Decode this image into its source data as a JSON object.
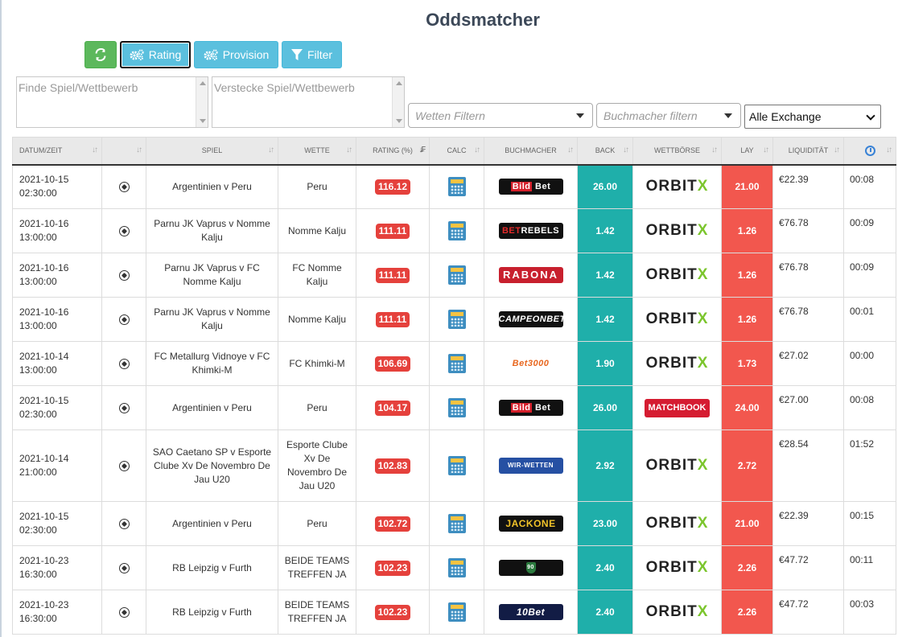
{
  "page": {
    "title": "Oddsmatcher"
  },
  "toolbar": {
    "rating_label": "Rating",
    "provision_label": "Provision",
    "filter_label": "Filter"
  },
  "filters": {
    "find_placeholder": "Finde Spiel/Wettbewerb",
    "hide_placeholder": "Verstecke Spiel/Wettbewerb",
    "bets_placeholder": "Wetten Filtern",
    "bookmaker_placeholder": "Buchmacher filtern",
    "exchange_value": "Alle Exchange"
  },
  "columns": {
    "date": "Datum/Zeit",
    "sport": "",
    "match": "Spiel",
    "bet": "Wette",
    "rating": "Rating (%)",
    "calc": "Calc",
    "bookmaker": "Buchmacher",
    "back": "Back",
    "exchange": "Wettbörse",
    "lay": "Lay",
    "liquidity": "Liquidität",
    "time": ""
  },
  "rows": [
    {
      "date": "2021-10-15",
      "time": "02:30:00",
      "match": "Argentinien v Peru",
      "bet": "Peru",
      "rating": "116.12",
      "bookmaker": "bildbet",
      "back": "26.00",
      "exchange": "orbitx",
      "lay": "21.00",
      "liquidity": "€22.39",
      "age": "00:08"
    },
    {
      "date": "2021-10-16",
      "time": "13:00:00",
      "match": "Parnu JK Vaprus v Nomme Kalju",
      "bet": "Nomme Kalju",
      "rating": "111.11",
      "bookmaker": "betrebels",
      "back": "1.42",
      "exchange": "orbitx",
      "lay": "1.26",
      "liquidity": "€76.78",
      "age": "00:09"
    },
    {
      "date": "2021-10-16",
      "time": "13:00:00",
      "match": "Parnu JK Vaprus v FC Nomme Kalju",
      "bet": "FC Nomme Kalju",
      "rating": "111.11",
      "bookmaker": "rabona",
      "back": "1.42",
      "exchange": "orbitx",
      "lay": "1.26",
      "liquidity": "€76.78",
      "age": "00:09"
    },
    {
      "date": "2021-10-16",
      "time": "13:00:00",
      "match": "Parnu JK Vaprus v Nomme Kalju",
      "bet": "Nomme Kalju",
      "rating": "111.11",
      "bookmaker": "campeonbet",
      "back": "1.42",
      "exchange": "orbitx",
      "lay": "1.26",
      "liquidity": "€76.78",
      "age": "00:01"
    },
    {
      "date": "2021-10-14",
      "time": "13:00:00",
      "match": "FC Metallurg Vidnoye v FC Khimki-M",
      "bet": "FC Khimki-M",
      "rating": "106.69",
      "bookmaker": "bet3000",
      "back": "1.90",
      "exchange": "orbitx",
      "lay": "1.73",
      "liquidity": "€27.02",
      "age": "00:00"
    },
    {
      "date": "2021-10-15",
      "time": "02:30:00",
      "match": "Argentinien v Peru",
      "bet": "Peru",
      "rating": "104.17",
      "bookmaker": "bildbet",
      "back": "26.00",
      "exchange": "matchbook",
      "lay": "24.00",
      "liquidity": "€27.00",
      "age": "00:08"
    },
    {
      "date": "2021-10-14",
      "time": "21:00:00",
      "match": "SAO Caetano SP v Esporte Clube Xv De Novembro De Jau U20",
      "bet": "Esporte Clube Xv De Novembro De Jau U20",
      "rating": "102.83",
      "bookmaker": "wirwetten",
      "back": "2.92",
      "exchange": "orbitx",
      "lay": "2.72",
      "liquidity": "€28.54",
      "age": "01:52"
    },
    {
      "date": "2021-10-15",
      "time": "02:30:00",
      "match": "Argentinien v Peru",
      "bet": "Peru",
      "rating": "102.72",
      "bookmaker": "jackone",
      "back": "23.00",
      "exchange": "orbitx",
      "lay": "21.00",
      "liquidity": "€22.39",
      "age": "00:15"
    },
    {
      "date": "2021-10-23",
      "time": "16:30:00",
      "match": "RB Leipzig v Furth",
      "bet": "BEIDE TEAMS TREFFEN JA",
      "rating": "102.23",
      "bookmaker": "ninety",
      "back": "2.40",
      "exchange": "orbitx",
      "lay": "2.26",
      "liquidity": "€47.72",
      "age": "00:11"
    },
    {
      "date": "2021-10-23",
      "time": "16:30:00",
      "match": "RB Leipzig v Furth",
      "bet": "BEIDE TEAMS TREFFEN JA",
      "rating": "102.23",
      "bookmaker": "tenbet",
      "back": "2.40",
      "exchange": "orbitx",
      "lay": "2.26",
      "liquidity": "€47.72",
      "age": "00:03"
    }
  ],
  "logos": {
    "bildbet": [
      "Bild",
      "Bet"
    ],
    "betrebels": [
      "BET",
      "REBELS"
    ],
    "rabona": "RABONA",
    "campeonbet": "CAMPEONBET",
    "bet3000": "Bet3000",
    "wirwetten": "WIR-WETTEN",
    "jackone": "JACKONE",
    "ninety": "90",
    "tenbet": "10Bet",
    "orbitx": [
      "ORBIT",
      "X"
    ],
    "matchbook": "MATCHBOOK"
  }
}
